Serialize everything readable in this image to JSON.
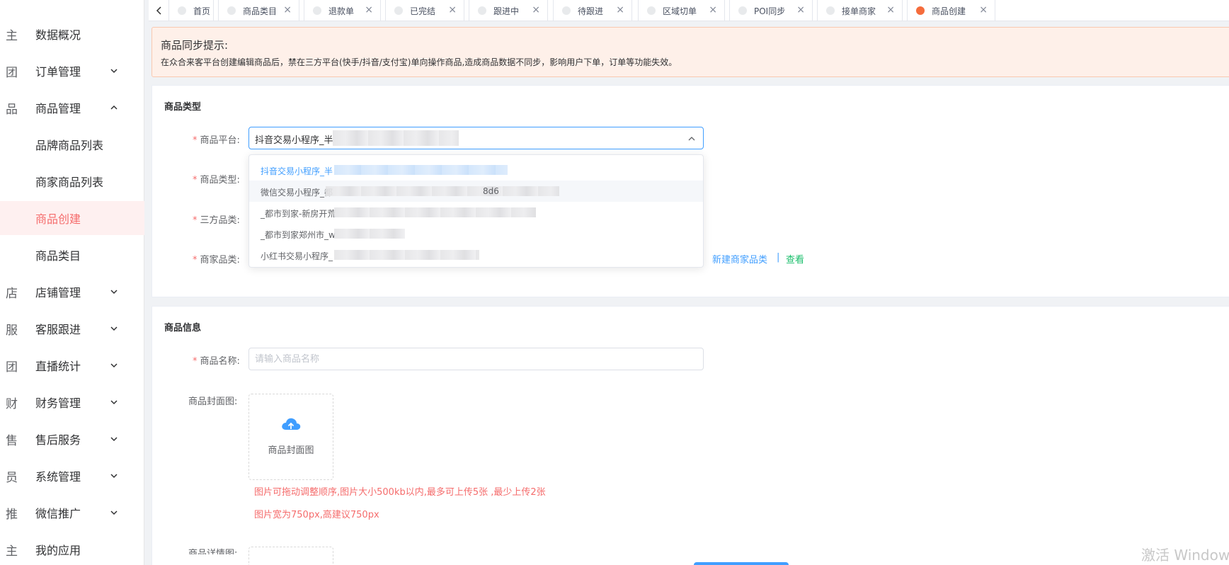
{
  "sidebar": {
    "items": [
      {
        "icon": "主",
        "label": "数据概况",
        "arrow": ""
      },
      {
        "icon": "团",
        "label": "订单管理",
        "arrow": "down"
      },
      {
        "icon": "品",
        "label": "商品管理",
        "arrow": "up"
      },
      {
        "icon": "",
        "label": "品牌商品列表",
        "arrow": ""
      },
      {
        "icon": "",
        "label": "商家商品列表",
        "arrow": ""
      },
      {
        "icon": "",
        "label": "商品创建",
        "arrow": "",
        "active": true
      },
      {
        "icon": "",
        "label": "商品类目",
        "arrow": ""
      },
      {
        "icon": "店",
        "label": "店铺管理",
        "arrow": "down"
      },
      {
        "icon": "服",
        "label": "客服跟进",
        "arrow": "down"
      },
      {
        "icon": "团",
        "label": "直播统计",
        "arrow": "down"
      },
      {
        "icon": "财",
        "label": "财务管理",
        "arrow": "down"
      },
      {
        "icon": "售",
        "label": "售后服务",
        "arrow": "down"
      },
      {
        "icon": "员",
        "label": "系统管理",
        "arrow": "down"
      },
      {
        "icon": "推",
        "label": "微信推广",
        "arrow": "down"
      },
      {
        "icon": "主",
        "label": "我的应用",
        "arrow": ""
      }
    ]
  },
  "tabs": [
    {
      "label": "首页",
      "closable": false
    },
    {
      "label": "商品类目",
      "closable": true
    },
    {
      "label": "退款单",
      "closable": true
    },
    {
      "label": "已完结",
      "closable": true
    },
    {
      "label": "跟进中",
      "closable": true
    },
    {
      "label": "待跟进",
      "closable": true
    },
    {
      "label": "区域切单",
      "closable": true
    },
    {
      "label": "POI同步",
      "closable": true
    },
    {
      "label": "接单商家",
      "closable": true
    },
    {
      "label": "商品创建",
      "closable": true,
      "active": true
    }
  ],
  "notice": {
    "title": "商品同步提示:",
    "text": "在众合来客平台创建编辑商品后，禁在三方平台(快手/抖音/支付宝)单向操作商品,造成商品数据不同步，影响用户下单，订单等功能失效。"
  },
  "section1": {
    "title": "商品类型",
    "platform_label": "商品平台:",
    "type_label": "商品类型:",
    "third_cat_label": "三方品类:",
    "merchant_cat_label": "商家品类:",
    "platform_value": "抖音交易小程序_半",
    "dropdown": [
      {
        "text": "抖音交易小程序_半",
        "selected": true
      },
      {
        "text": "微信交易小程序_都",
        "suffix": "8d6",
        "hover": true
      },
      {
        "text": "_都市到家-新房开荒"
      },
      {
        "text": "_都市到家郑州市_w"
      },
      {
        "text": "小红书交易小程序_"
      }
    ],
    "new_cat_link": "新建商家品类",
    "separator": "|",
    "view_link": "查看"
  },
  "section2": {
    "title": "商品信息",
    "name_label": "商品名称:",
    "name_placeholder": "请输入商品名称",
    "cover_label": "商品封面图:",
    "cover_upload": "商品封面图",
    "hint1": "图片可拖动调整顺序,图片大小500kb以内,最多可上传5张  ,最少上传2张",
    "hint2": "图片宽为750px,高建议750px",
    "detail_label": "商品详情图:"
  },
  "watermark": "激活 Window"
}
